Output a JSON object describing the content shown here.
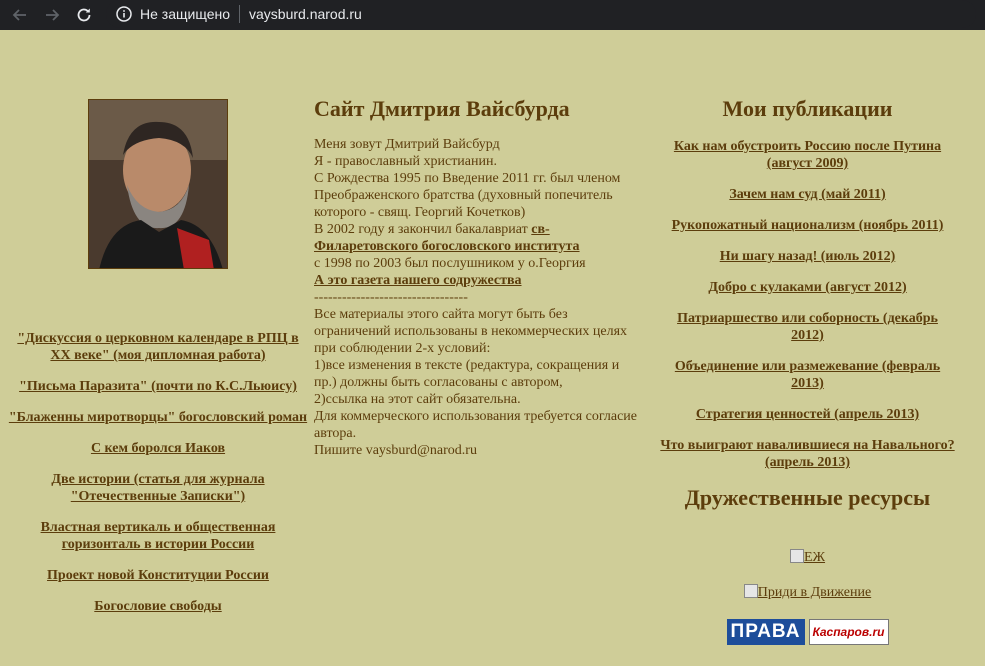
{
  "browser": {
    "security": "Не защищено",
    "url": "vaysburd.narod.ru"
  },
  "left": {
    "links": [
      "\"Дискуссия о церковном календаре в РПЦ в ХХ веке\" (моя дипломная работа)",
      "\"Письма Паразита\" (почти по К.С.Льюису)",
      "\"Блаженны миротворцы\" богословский роман",
      "С кем боролся Иаков",
      "Две истории (статья для журнала \"Отечественные Записки\")",
      "Властная вертикаль и общественная горизонталь в истории России",
      "Проект новой Конституции России",
      "Богословие свободы"
    ]
  },
  "mid": {
    "title": "Сайт Дмитрия Вайсбурда",
    "lines": {
      "l1": "Меня зовут Дмитрий Вайсбурд",
      "l2": "Я - православный христианин.",
      "l3": "С Рождества 1995 по Введение 2011 гг. был членом",
      "l4": "Преображенского братства (духовный попечитель",
      "l5": "которого - свящ. Георгий Кочетков)",
      "l6a": "В 2002 году я закончил бакалавриат ",
      "l6link": "св-",
      "l7link": "Филаретовского богословского института",
      "l8": "с 1998 по 2003 был послушником у о.Георгия",
      "l9link": "А это газета нашего содружества",
      "l10": "---------------------------------",
      "l11": "Все материалы этого сайта могут быть без",
      "l12": "ограничений использованы в некоммерческих целях",
      "l13": "при соблюдении 2-х условий:",
      "l14": "1)все изменения в тексте (редактура, сокращения и",
      "l15": "пр.) должны быть согласованы с автором,",
      "l16": "2)ссылка на этот сайт обязательна.",
      "l17": "Для коммерческого использования требуется согласие",
      "l18": "автора.",
      "l19": "Пишите vaysburd@narod.ru"
    }
  },
  "right": {
    "title": "Мои публикации",
    "links": [
      "Как нам обустроить Россию после Путина (август 2009)",
      "Зачем нам суд (май 2011)",
      "Рукопожатный национализм (ноябрь 2011)",
      "Ни шагу назад! (июль 2012)",
      "Добро с кулаками (август 2012)",
      "Патриаршество или соборность (декабрь 2012)",
      "Объединение или размежевание (февраль 2013)",
      "Стратегия ценностей (апрель 2013)",
      "Что выиграют навалившиеся на Навального? (апрель 2013)"
    ],
    "friends_title": "Дружественные ресурсы",
    "res1": "ЕЖ",
    "res2": "Приди в Движение",
    "banner1": "ПРАВА",
    "banner2": "Каспаров.ru"
  }
}
